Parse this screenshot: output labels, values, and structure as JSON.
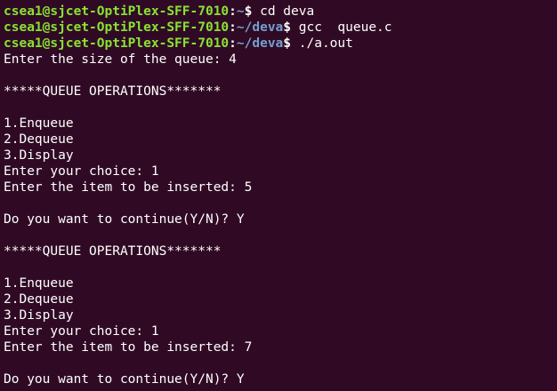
{
  "terminal": {
    "prompts": [
      {
        "user_host": "csea1@sjcet-OptiPlex-SFF-7010",
        "path": "~",
        "symbol": "$",
        "command": " cd deva"
      },
      {
        "user_host": "csea1@sjcet-OptiPlex-SFF-7010",
        "path": "~/deva",
        "symbol": "$",
        "command": " gcc  queue.c"
      },
      {
        "user_host": "csea1@sjcet-OptiPlex-SFF-7010",
        "path": "~/deva",
        "symbol": "$",
        "command": " ./a.out"
      }
    ],
    "output": [
      "Enter the size of the queue: 4",
      "",
      "*****QUEUE OPERATIONS*******",
      "",
      "1.Enqueue",
      "2.Dequeue",
      "3.Display",
      "Enter your choice: 1",
      "Enter the item to be inserted: 5",
      "",
      "Do you want to continue(Y/N)? Y",
      "",
      "*****QUEUE OPERATIONS*******",
      "",
      "1.Enqueue",
      "2.Dequeue",
      "3.Display",
      "Enter your choice: 1",
      "Enter the item to be inserted: 7",
      "",
      "Do you want to continue(Y/N)? Y"
    ]
  },
  "colors": {
    "background": "#300a24",
    "user_host": "#8ae234",
    "path": "#729fcf",
    "text": "#ffffff"
  }
}
